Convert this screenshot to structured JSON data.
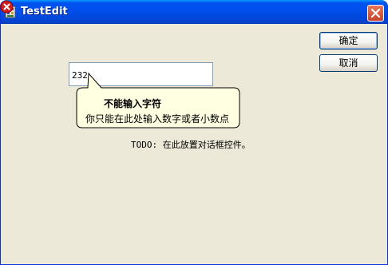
{
  "window": {
    "title": "TestEdit",
    "title_icon": "app-icon",
    "close_icon": "close-icon"
  },
  "buttons": {
    "ok_label": "确定",
    "cancel_label": "取消"
  },
  "edit": {
    "value": "232"
  },
  "balloon": {
    "icon": "error-icon",
    "title": "不能输入字符",
    "text": "你只能在此处输入数字或者小数点"
  },
  "dialog": {
    "placeholder_text": "TODO: 在此放置对话框控件。"
  },
  "colors": {
    "titlebar": "#0053ee",
    "window_bg": "#ece9d8",
    "close_button": "#c8442a",
    "balloon_bg": "#ffffe1"
  }
}
